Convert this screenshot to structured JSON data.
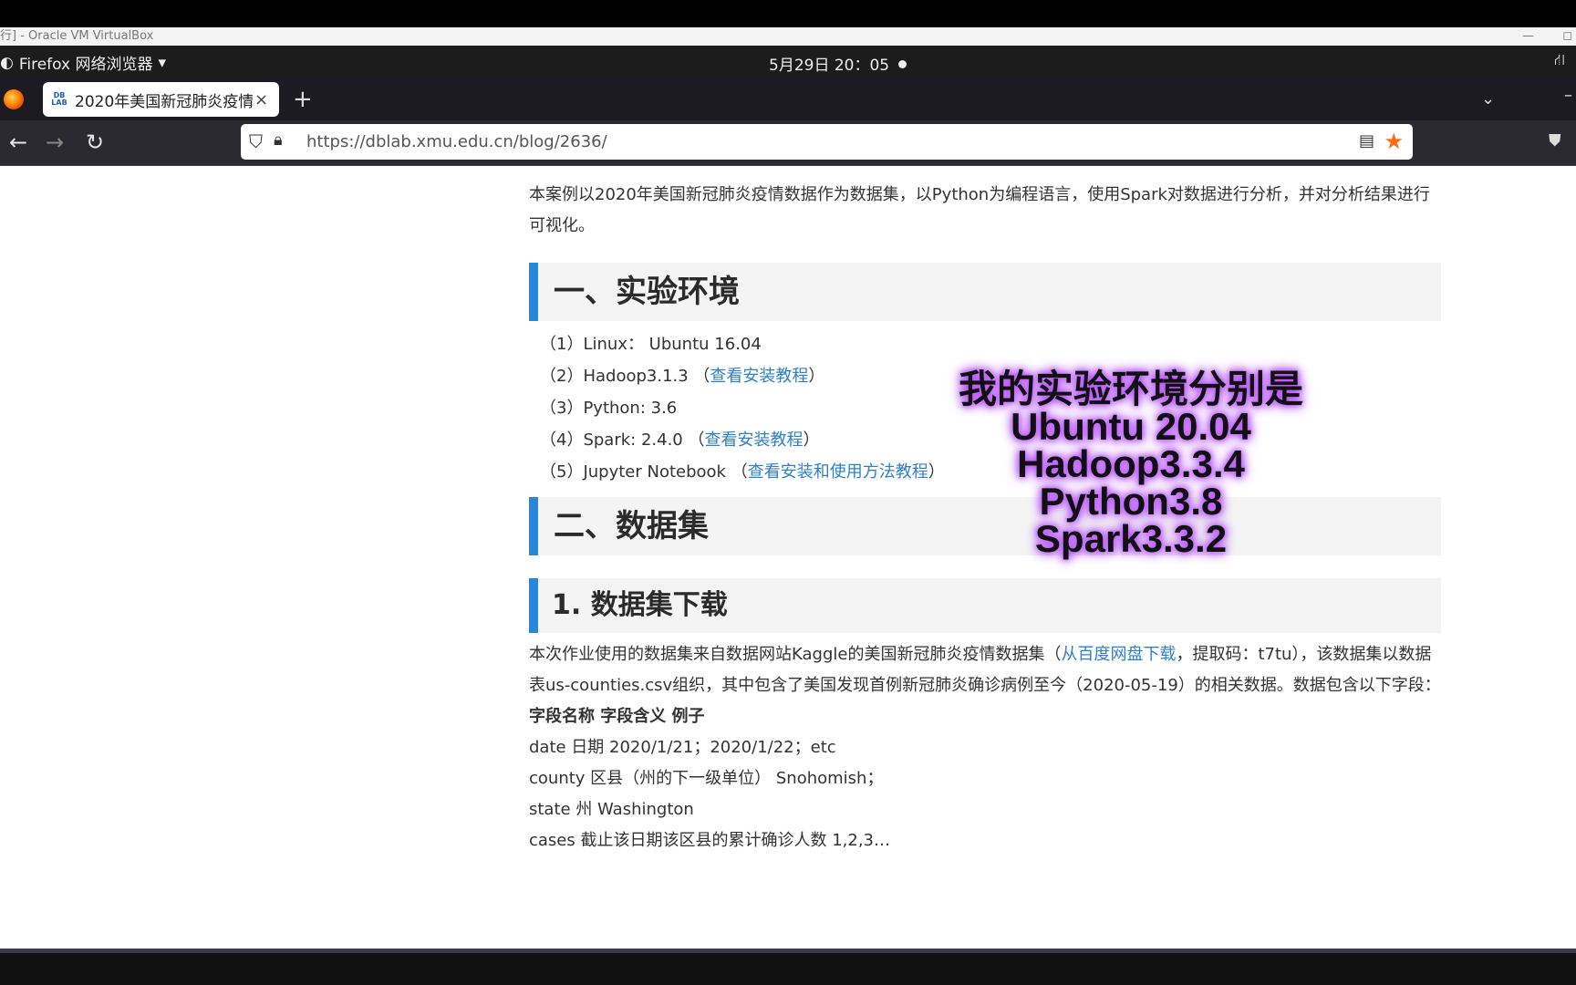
{
  "vbox": {
    "title": "行] - Oracle VM VirtualBox",
    "minimize": "—",
    "restore": "◻"
  },
  "topbar": {
    "app_name": "Firefox 网络浏览器",
    "clock": "5月29日 20：05"
  },
  "tabs": [
    {
      "favicon": "DB LAB",
      "title": "2020年美国新冠肺炎疫情",
      "close": "×"
    }
  ],
  "browser": {
    "new_tab": "+",
    "url": "https://dblab.xmu.edu.cn/blog/2636/"
  },
  "article": {
    "intro": "本案例以2020年美国新冠肺炎疫情数据作为数据集，以Python为编程语言，使用Spark对数据进行分析，并对分析结果进行可视化。",
    "h_env": "一、实验环境",
    "env_items": [
      {
        "text": "（1）Linux： Ubuntu 16.04",
        "link": "",
        "tail": ""
      },
      {
        "text": "（2）Hadoop3.1.3 （",
        "link": "查看安装教程",
        "tail": "）"
      },
      {
        "text": "（3）Python: 3.6",
        "link": "",
        "tail": ""
      },
      {
        "text": "（4）Spark: 2.4.0 （",
        "link": "查看安装教程",
        "tail": "）"
      },
      {
        "text": "（5）Jupyter Notebook （",
        "link": "查看安装和使用方法教程",
        "tail": "）"
      }
    ],
    "h_dataset": "二、数据集",
    "h_download": "1. 数据集下载",
    "download_p1_a": "本次作业使用的数据集来自数据网站Kaggle的美国新冠肺炎疫情数据集（",
    "download_link": "从百度网盘下载",
    "download_p1_b": "，提取码：t7tu），该数据集以数据表us-counties.csv组织，其中包含了美国发现首例新冠肺炎确诊病例至今（2020-05-19）的相关数据。数据包含以下字段：",
    "fields_header": "字段名称 字段含义 例子",
    "fields": [
      "date 日期 2020/1/21；2020/1/22；etc",
      "county 区县（州的下一级单位） Snohomish；",
      "state 州 Washington",
      "cases 截止该日期该区县的累计确诊人数 1,2,3…"
    ]
  },
  "overlay": {
    "lines": [
      "我的实验环境分别是",
      "Ubuntu 20.04",
      "Hadoop3.3.4",
      "Python3.8",
      "Spark3.3.2"
    ]
  }
}
